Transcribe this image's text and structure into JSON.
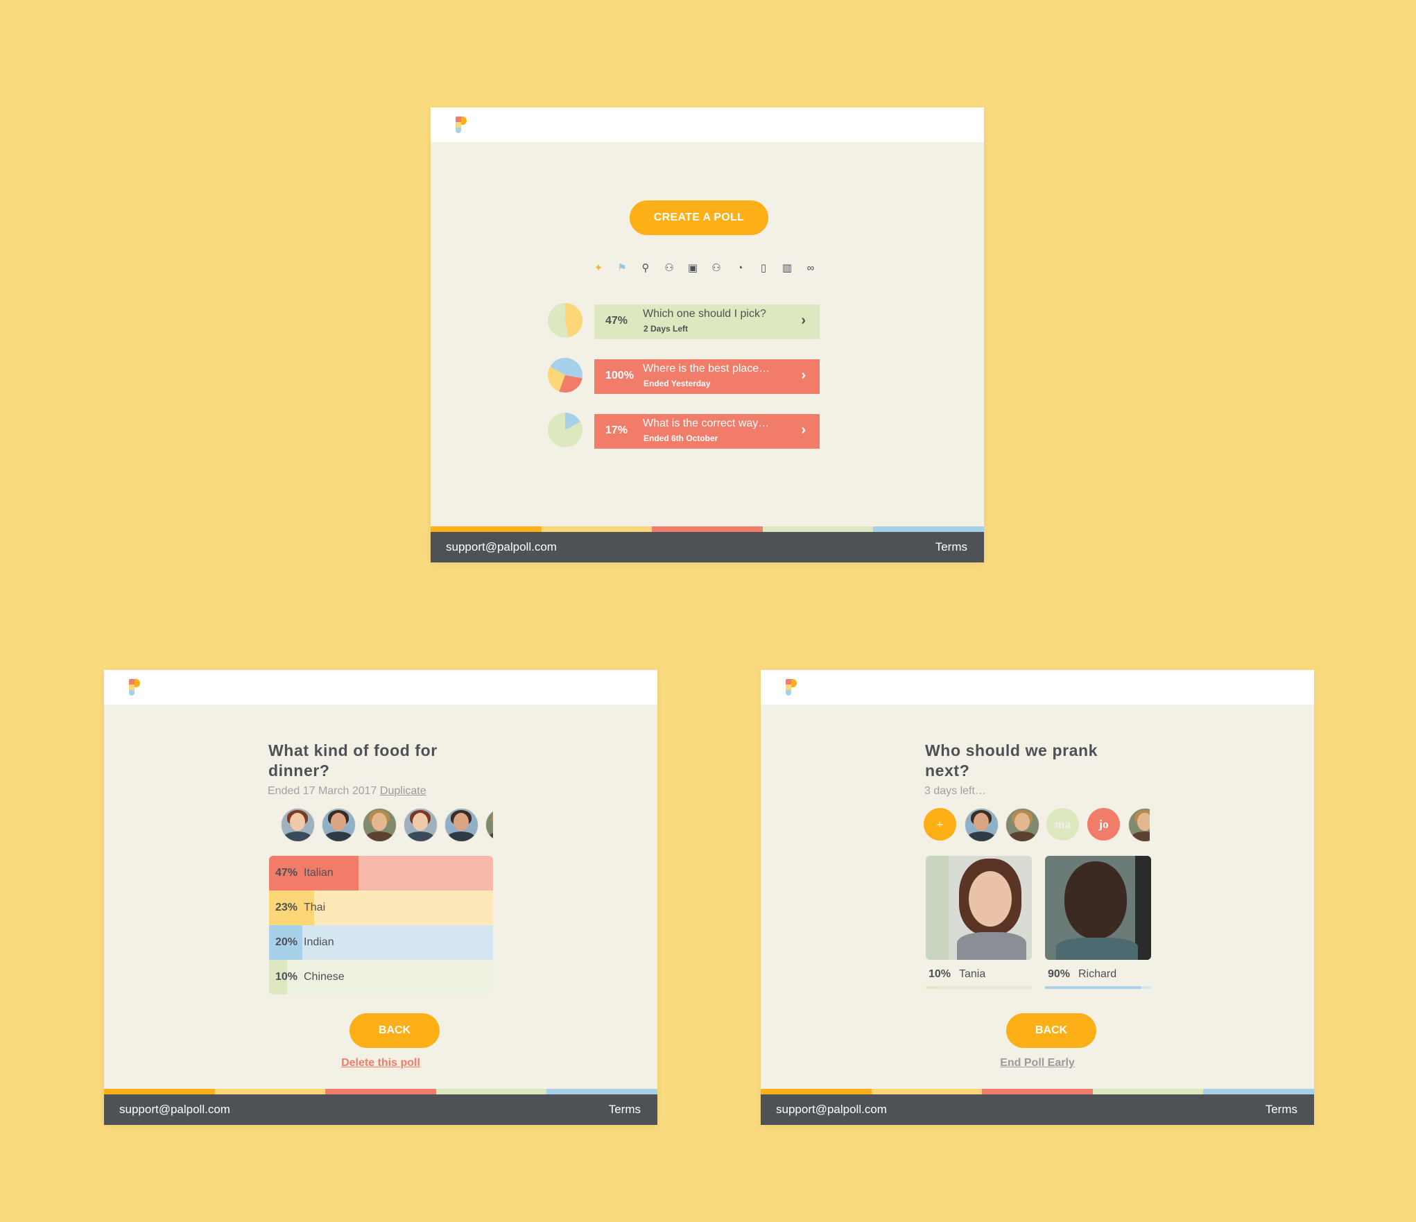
{
  "colors": {
    "background": "#f9da7e",
    "panel": "#f3f0e6",
    "orange": "#fdaf17",
    "coral": "#f07c69",
    "green": "#dde8c0",
    "yellow": "#ffdd7c",
    "blue": "#a7d1e8",
    "footer": "#4e5156",
    "text": "#4d5156"
  },
  "common": {
    "support_email": "support@palpoll.com",
    "terms": "Terms"
  },
  "list_screen": {
    "create_label": "CREATE A POLL",
    "icons": [
      "lightbulb-icon",
      "flag-icon",
      "pin-icon",
      "person-icon",
      "camera-icon",
      "person-icon",
      "clock-icon",
      "bottle-icon",
      "building-icon",
      "link-icon"
    ],
    "polls": [
      {
        "pct": "47%",
        "question": "Which one should I pick?",
        "status": "2 Days Left",
        "color": "#dde8c0",
        "text_color": "#4d5156"
      },
      {
        "pct": "100%",
        "question": "Where is the best place…",
        "status": "Ended Yesterday",
        "color": "#f07c69",
        "text_color": "#ffffff"
      },
      {
        "pct": "17%",
        "question": "What is the correct way…",
        "status": "Ended 6th October",
        "color": "#f07c69",
        "text_color": "#ffffff"
      }
    ]
  },
  "food_screen": {
    "title": "What kind of food for dinner?",
    "ended": "Ended 17 March 2017",
    "duplicate": "Duplicate",
    "results": [
      {
        "pct": "47%",
        "label": "Italian",
        "value": 0.47,
        "fill": "#f07c69",
        "bg": "#f7b9ab"
      },
      {
        "pct": "23%",
        "label": "Thai",
        "value": 0.23,
        "fill": "#fcd677",
        "bg": "#fde9b8"
      },
      {
        "pct": "20%",
        "label": "Indian",
        "value": 0.2,
        "fill": "#a7d1e8",
        "bg": "#d4e6ef"
      },
      {
        "pct": "10%",
        "label": "Chinese",
        "value": 0.1,
        "fill": "#dde8c0",
        "bg": "#edf1e0"
      }
    ],
    "back_label": "BACK",
    "delete_label": "Delete this poll"
  },
  "prank_screen": {
    "title": "Who should we prank next?",
    "time_left": "3 days left…",
    "add_label": "+",
    "initials": [
      "ma",
      "jo"
    ],
    "candidates": [
      {
        "pct": "10%",
        "name": "Tania",
        "value": 0.1,
        "bar": "#dde8c0"
      },
      {
        "pct": "90%",
        "name": "Richard",
        "value": 0.9,
        "bar": "#a7d1e8"
      }
    ],
    "back_label": "BACK",
    "end_label": "End Poll Early"
  }
}
